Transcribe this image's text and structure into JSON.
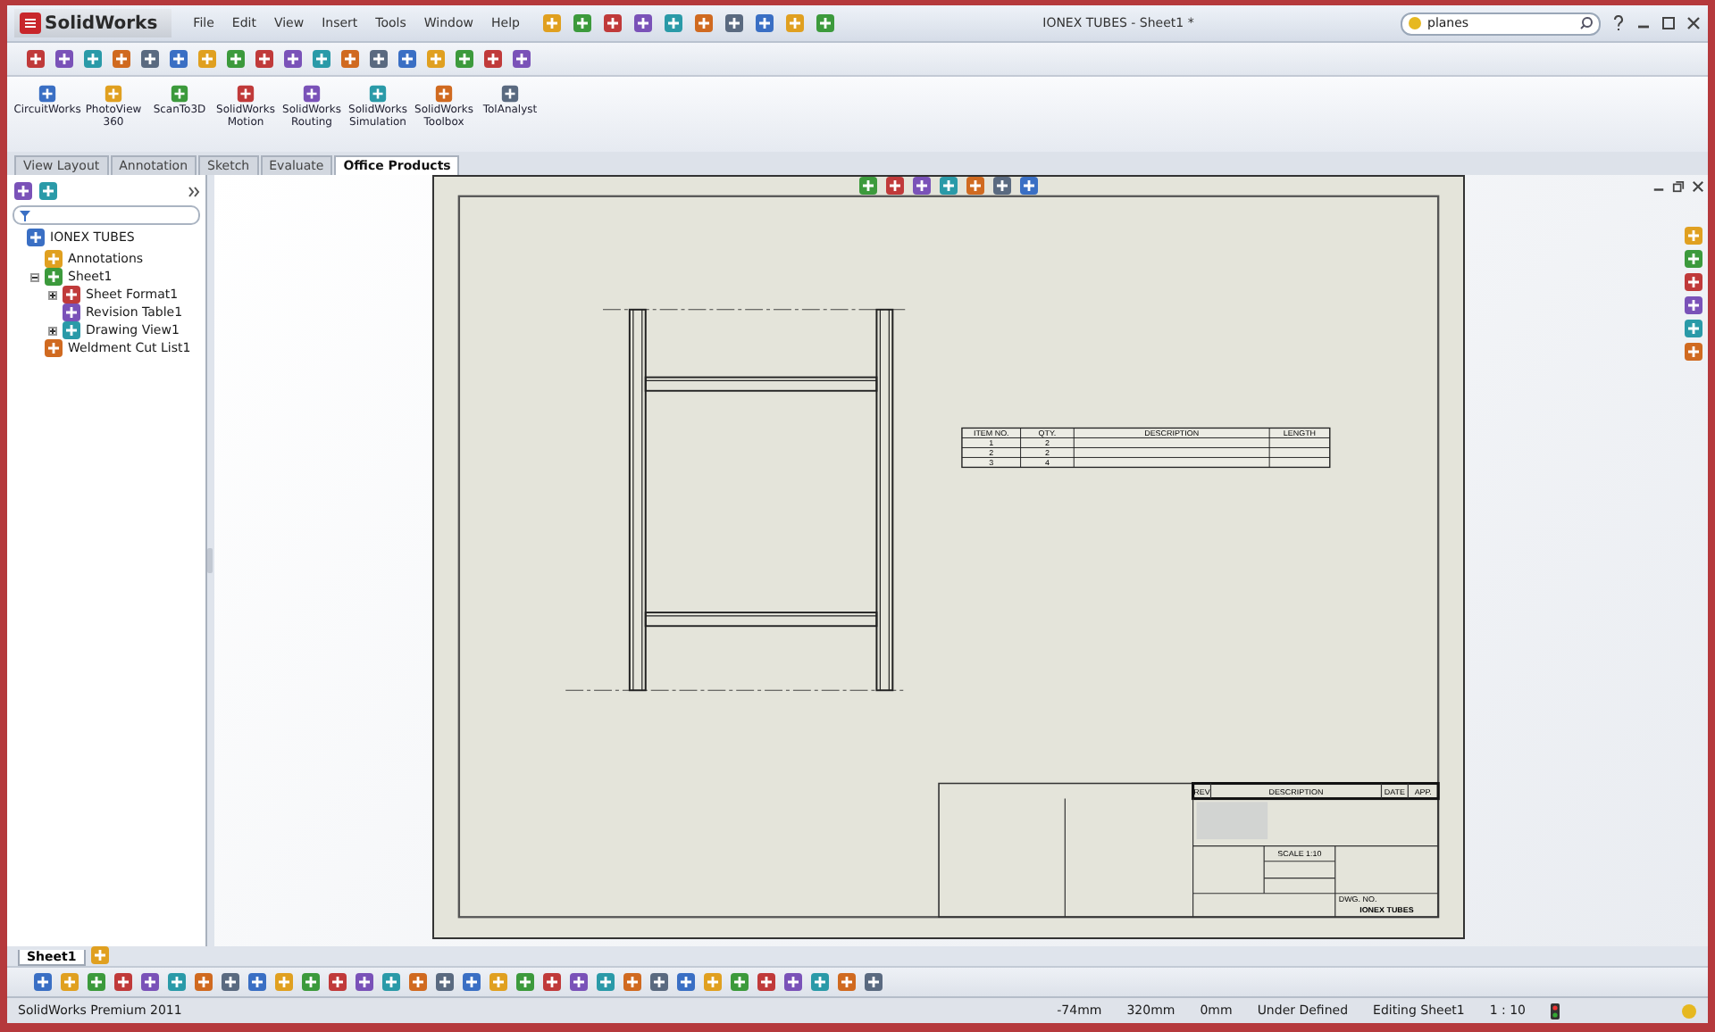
{
  "window": {
    "app": "SolidWorks",
    "title": "IONEX TUBES - Sheet1 *"
  },
  "menu": [
    "File",
    "Edit",
    "View",
    "Insert",
    "Tools",
    "Window",
    "Help"
  ],
  "search": {
    "value": "planes"
  },
  "command_manager": [
    {
      "label": "CircuitWorks"
    },
    {
      "label": "PhotoView 360"
    },
    {
      "label": "ScanTo3D"
    },
    {
      "label": "SolidWorks Motion"
    },
    {
      "label": "SolidWorks Routing"
    },
    {
      "label": "SolidWorks Simulation"
    },
    {
      "label": "SolidWorks Toolbox"
    },
    {
      "label": "TolAnalyst"
    }
  ],
  "tabs": [
    {
      "label": "View Layout",
      "selected": false
    },
    {
      "label": "Annotation",
      "selected": false
    },
    {
      "label": "Sketch",
      "selected": false
    },
    {
      "label": "Evaluate",
      "selected": false
    },
    {
      "label": "Office Products",
      "selected": true
    }
  ],
  "tree": [
    {
      "label": "IONEX TUBES",
      "children": [
        {
          "label": "Annotations"
        },
        {
          "label": "Sheet1",
          "expanded": true,
          "children": [
            {
              "label": "Sheet Format1",
              "expanded": false
            },
            {
              "label": "Revision Table1"
            },
            {
              "label": "Drawing View1",
              "expanded": false
            }
          ]
        },
        {
          "label": "Weldment Cut List1"
        }
      ]
    }
  ],
  "sheet": {
    "bom": {
      "columns": [
        "ITEM NO.",
        "QTY.",
        "DESCRIPTION",
        "LENGTH"
      ],
      "rows": [
        [
          "1",
          "2",
          "",
          ""
        ],
        [
          "2",
          "2",
          "",
          ""
        ],
        [
          "3",
          "4",
          "",
          ""
        ]
      ]
    },
    "title_block": {
      "rev_columns": [
        "REV",
        "DESCRIPTION",
        "DATE",
        "APP."
      ],
      "scale": "SCALE 1:10",
      "dwg_label": "DWG. NO.",
      "dwg_no": "IONEX TUBES"
    }
  },
  "sheet_tabs": [
    {
      "label": "Sheet1",
      "selected": true
    }
  ],
  "status_bar": {
    "product": "SolidWorks Premium 2011",
    "items": [
      "-74mm",
      "320mm",
      "0mm",
      "Under Defined",
      "Editing Sheet1",
      "1 : 10"
    ]
  }
}
